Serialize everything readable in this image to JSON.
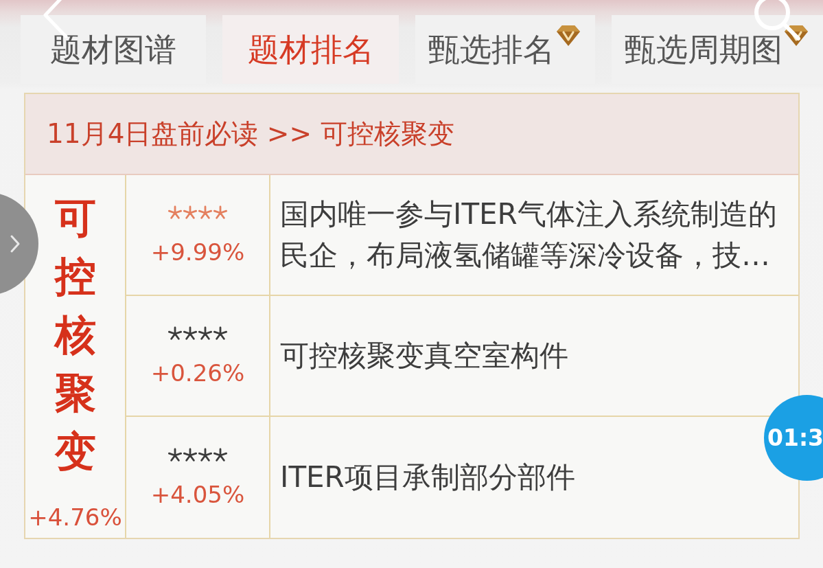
{
  "tabs": [
    {
      "label": "题材图谱",
      "selected": false,
      "premium": false
    },
    {
      "label": "题材排名",
      "selected": true,
      "premium": false
    },
    {
      "label": "甄选排名",
      "selected": false,
      "premium": true
    },
    {
      "label": "甄选周期图",
      "selected": false,
      "premium": true
    }
  ],
  "card": {
    "header": "11月4日盘前必读 >> 可控核聚变",
    "theme": {
      "name": "可控核聚变",
      "change": "+4.76%"
    },
    "rows": [
      {
        "stars": 4,
        "color": "#e4805f",
        "change": "+9.99%",
        "description": "国内唯一参与ITER气体注入系统制造的民企，布局液氢储罐等深冷设备，技…"
      },
      {
        "stars": 4,
        "color": "#3c3c3c",
        "change": "+0.26%",
        "description": "可控核聚变真空室构件"
      },
      {
        "stars": 4,
        "color": "#3c3c3c",
        "change": "+4.05%",
        "description": "ITER项目承制部分部件"
      }
    ]
  },
  "timer": {
    "text": "01:3"
  }
}
